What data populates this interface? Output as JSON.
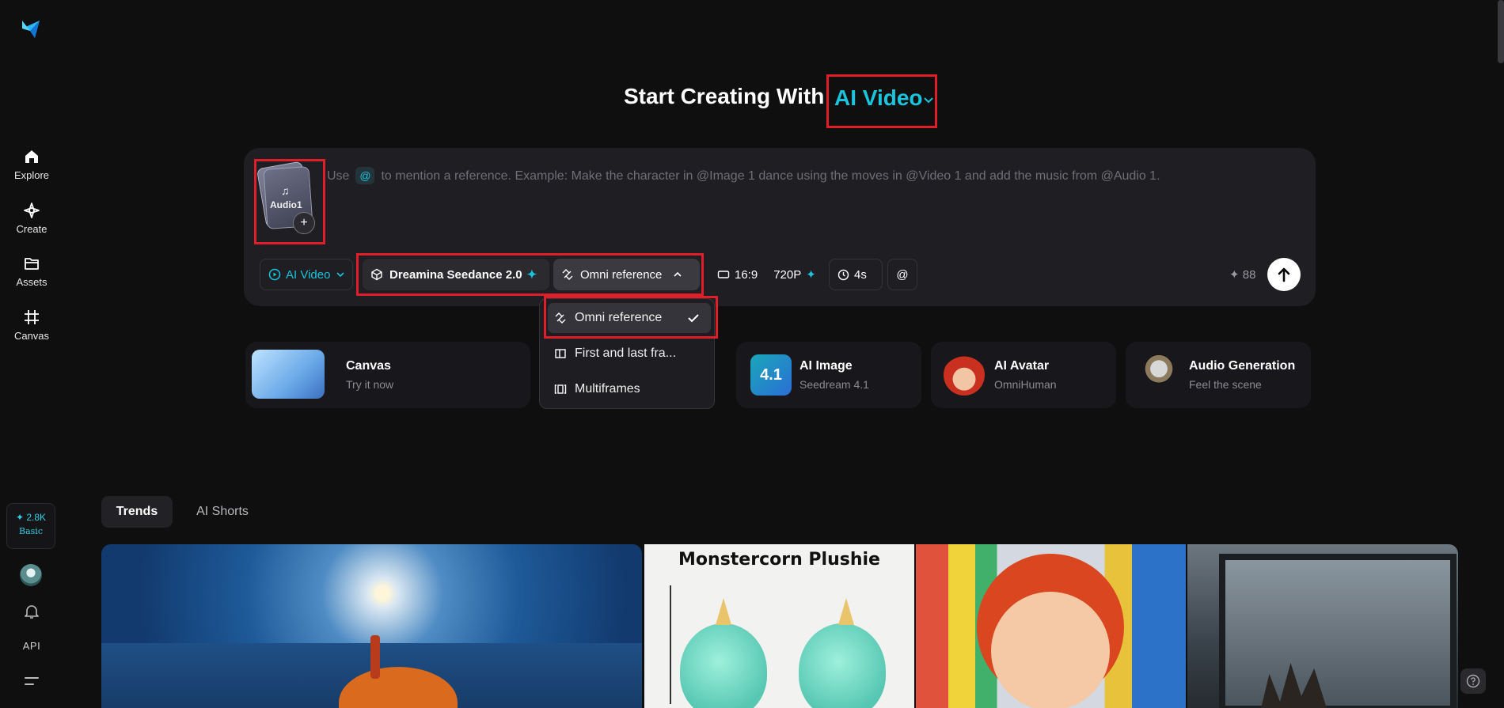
{
  "sidebar": {
    "items": [
      {
        "label": "Explore",
        "icon": "home-icon"
      },
      {
        "label": "Create",
        "icon": "sparkle-icon"
      },
      {
        "label": "Assets",
        "icon": "folder-icon"
      },
      {
        "label": "Canvas",
        "icon": "canvas-icon"
      }
    ],
    "credits": {
      "amount": "✦ 2.8K",
      "tier": "Basic"
    },
    "api_label": "API"
  },
  "heading": {
    "prefix": "Start Creating With",
    "mode": "AI Video"
  },
  "prompt": {
    "placeholder_before": "Use",
    "placeholder_at": "@",
    "placeholder_after": "to mention a reference. Example: Make the character in @Image 1 dance using the moves in @Video 1 and add the music from @Audio 1.",
    "reference_label": "Audio1",
    "reference_add": "+"
  },
  "toolbar": {
    "mode_label": "AI Video",
    "model_label": "Dreamina Seedance 2.0",
    "reference_label": "Omni reference",
    "ratio_label": "16:9",
    "resolution_label": "720P",
    "duration_label": "4s",
    "mention_label": "@",
    "cost": "✦ 88",
    "accent": "#19c4dc"
  },
  "dropdown": {
    "items": [
      "Omni reference",
      "First and last fra...",
      "Multiframes"
    ],
    "selected": "Omni reference"
  },
  "feature_cards": [
    {
      "title": "Canvas",
      "subtitle": "Try it now"
    },
    {
      "title": "AI Image",
      "subtitle": "Seedream 4.1",
      "badge": "4.1"
    },
    {
      "title": "AI Avatar",
      "subtitle": "OmniHuman"
    },
    {
      "title": "Audio Generation",
      "subtitle": "Feel the scene"
    }
  ],
  "tabs": [
    "Trends",
    "AI Shorts"
  ],
  "gallery": {
    "card2_title": "Monstercorn Plushie"
  }
}
